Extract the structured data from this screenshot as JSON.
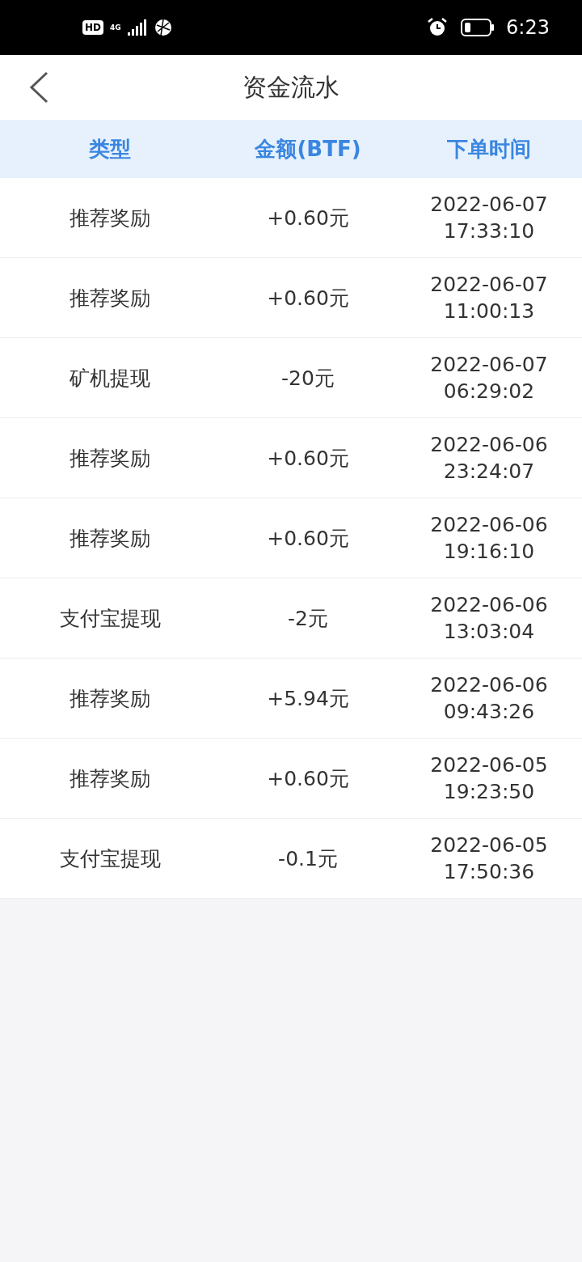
{
  "status_bar": {
    "hd_badge": "HD",
    "network": "4G",
    "time": "6:23"
  },
  "nav": {
    "title": "资金流水"
  },
  "table": {
    "columns": [
      "类型",
      "金额(BTF)",
      "下单时间"
    ],
    "rows": [
      {
        "type": "推荐奖励",
        "amount": "+0.60元",
        "date": "2022-06-07",
        "time": "17:33:10"
      },
      {
        "type": "推荐奖励",
        "amount": "+0.60元",
        "date": "2022-06-07",
        "time": "11:00:13"
      },
      {
        "type": "矿机提现",
        "amount": "-20元",
        "date": "2022-06-07",
        "time": "06:29:02"
      },
      {
        "type": "推荐奖励",
        "amount": "+0.60元",
        "date": "2022-06-06",
        "time": "23:24:07"
      },
      {
        "type": "推荐奖励",
        "amount": "+0.60元",
        "date": "2022-06-06",
        "time": "19:16:10"
      },
      {
        "type": "支付宝提现",
        "amount": "-2元",
        "date": "2022-06-06",
        "time": "13:03:04"
      },
      {
        "type": "推荐奖励",
        "amount": "+5.94元",
        "date": "2022-06-06",
        "time": "09:43:26"
      },
      {
        "type": "推荐奖励",
        "amount": "+0.60元",
        "date": "2022-06-05",
        "time": "19:23:50"
      },
      {
        "type": "支付宝提现",
        "amount": "-0.1元",
        "date": "2022-06-05",
        "time": "17:50:36"
      }
    ]
  }
}
